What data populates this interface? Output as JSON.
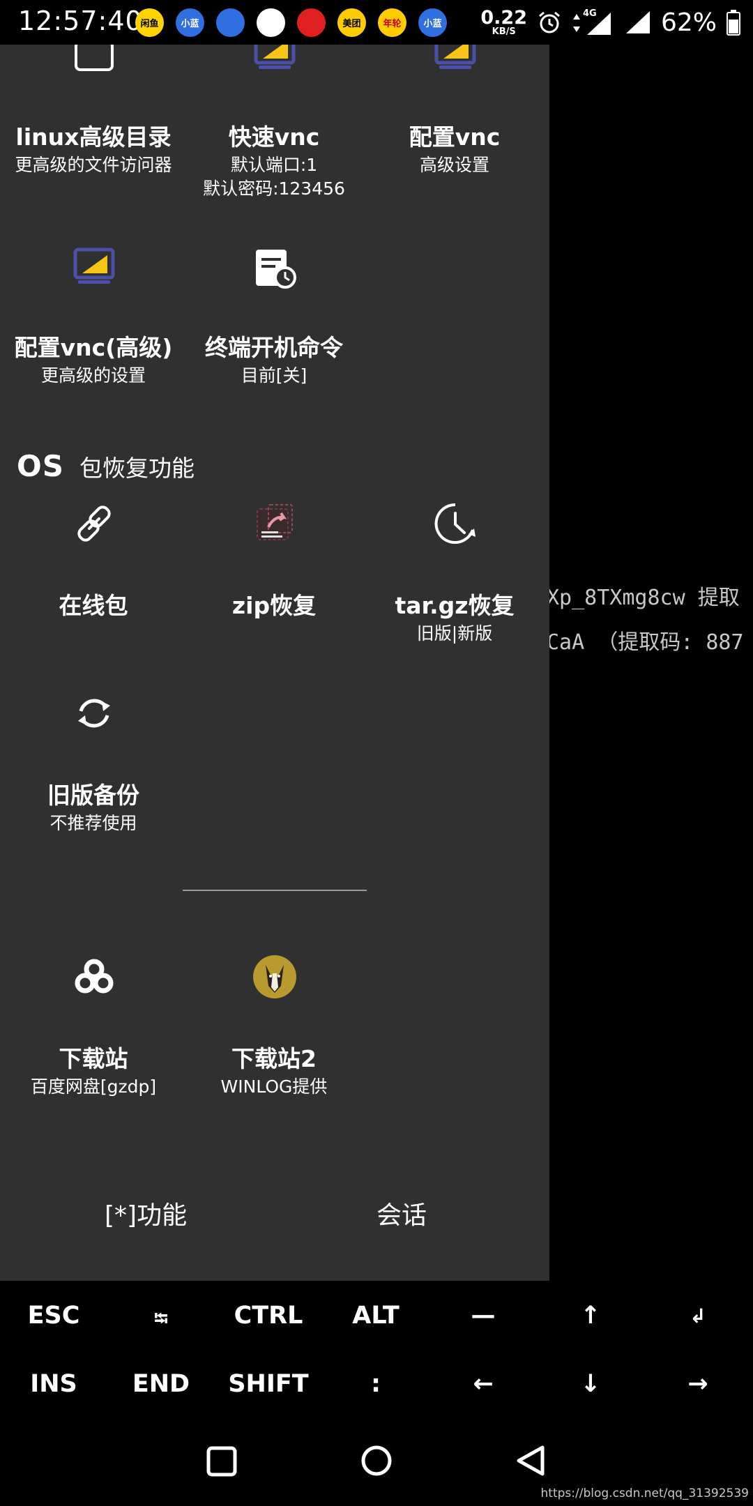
{
  "status_bar": {
    "time": "12:57:40",
    "notification_icons": [
      {
        "name": "xianyu-app-icon",
        "label": "闲鱼",
        "bg": "#ffd400",
        "fg": "#000"
      },
      {
        "name": "xiaolan-app-icon",
        "label": "小蓝",
        "bg": "#2f6fe0",
        "fg": "#fff"
      },
      {
        "name": "bird-app-icon",
        "label": "",
        "bg": "#2f6fe0",
        "fg": "#fff"
      },
      {
        "name": "baidu-netdisk-app-icon",
        "label": "",
        "bg": "#ffffff",
        "fg": "#2f6fe0"
      },
      {
        "name": "netease-music-app-icon",
        "label": "",
        "bg": "#e02020",
        "fg": "#fff"
      },
      {
        "name": "meituan-app-icon",
        "label": "美团",
        "bg": "#ffcc00",
        "fg": "#000"
      },
      {
        "name": "promo-app-icon",
        "label": "年轮",
        "bg": "#ffcc00",
        "fg": "#c00"
      },
      {
        "name": "xiaolan-app-icon-2",
        "label": "小蓝",
        "bg": "#2f6fe0",
        "fg": "#fff"
      }
    ],
    "net_speed_value": "0.22",
    "net_speed_unit": "KB/S",
    "network_type": "4G",
    "battery_percent": "62%"
  },
  "terminal": {
    "line1": "Xp_8TXmg8cw 提取",
    "line2": "CaA （提取码: 887"
  },
  "drawer": {
    "items": [
      {
        "title": "linux高级目录",
        "subtitle": "更高级的文件访问器",
        "subtitle2": ""
      },
      {
        "title": "快速vnc",
        "subtitle": "默认端口:1",
        "subtitle2": "默认密码:123456"
      },
      {
        "title": "配置vnc",
        "subtitle": "高级设置",
        "subtitle2": ""
      },
      {
        "title": "配置vnc(高级)",
        "subtitle": "更高级的设置",
        "subtitle2": ""
      },
      {
        "title": "终端开机命令",
        "subtitle": "目前[关]",
        "subtitle2": ""
      }
    ],
    "section_logo": "OS",
    "section_title": "包恢复功能",
    "recovery_items": [
      {
        "title": "在线包",
        "subtitle": ""
      },
      {
        "title": "zip恢复",
        "subtitle": ""
      },
      {
        "title": "tar.gz恢复",
        "subtitle": "旧版|新版"
      },
      {
        "title": "旧版备份",
        "subtitle": "不推荐使用"
      }
    ],
    "download_items": [
      {
        "title": "下载站",
        "subtitle": "百度网盘[gzdp]"
      },
      {
        "title": "下载站2",
        "subtitle": "WINLOG提供"
      }
    ],
    "bottom_buttons": {
      "functions": "[*]功能",
      "sessions": "会话"
    }
  },
  "extra_keys": {
    "row1": [
      "ESC",
      "⭾",
      "CTRL",
      "ALT",
      "—",
      "↑",
      "↲"
    ],
    "row2": [
      "INS",
      "END",
      "SHIFT",
      ":",
      "←",
      "↓",
      "→"
    ]
  },
  "watermark": "https://blog.csdn.net/qq_31392539",
  "colors": {
    "drawer_bg": "#303030",
    "accent_yellow": "#f5c518",
    "accent_blue": "#4b4fa8",
    "status_bg": "#000000"
  }
}
